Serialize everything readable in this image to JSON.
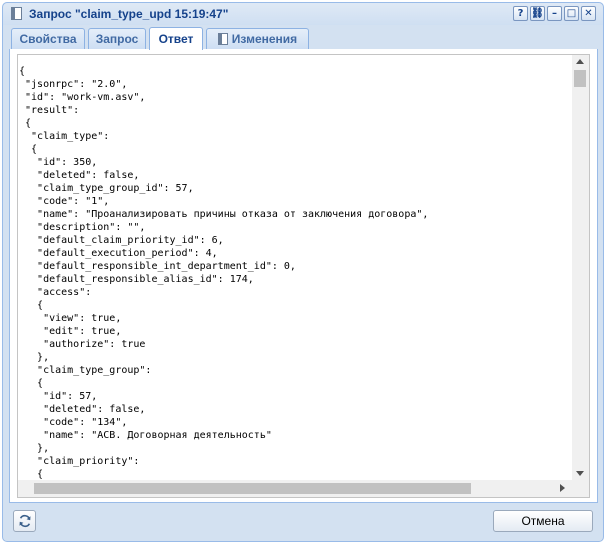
{
  "window": {
    "title": "Запрос \"claim_type_upd 15:19:47\"",
    "tool_help": "?",
    "tool_pin": "⛓",
    "tool_minimize": "–",
    "tool_maximize": "□",
    "tool_close": "✕"
  },
  "tabs": [
    {
      "label": "Свойства",
      "active": false
    },
    {
      "label": "Запрос",
      "active": false
    },
    {
      "label": "Ответ",
      "active": true
    },
    {
      "label": "Изменения",
      "active": false
    }
  ],
  "response_text": "{\n \"jsonrpc\": \"2.0\",\n \"id\": \"work-vm.asv\",\n \"result\":\n {\n  \"claim_type\":\n  {\n   \"id\": 350,\n   \"deleted\": false,\n   \"claim_type_group_id\": 57,\n   \"code\": \"1\",\n   \"name\": \"Проанализировать причины отказа от заключения договора\",\n   \"description\": \"\",\n   \"default_claim_priority_id\": 6,\n   \"default_execution_period\": 4,\n   \"default_responsible_int_department_id\": 0,\n   \"default_responsible_alias_id\": 174,\n   \"access\":\n   {\n    \"view\": true,\n    \"edit\": true,\n    \"authorize\": true\n   },\n   \"claim_type_group\":\n   {\n    \"id\": 57,\n    \"deleted\": false,\n    \"code\": \"134\",\n    \"name\": \"АСВ. Договорная деятельность\"\n   },\n   \"claim_priority\":\n   {",
  "footer": {
    "cancel_label": "Отмена"
  },
  "colors": {
    "window_bg": "#d3e1f1",
    "title_text": "#15428b",
    "border": "#99bbe8"
  }
}
